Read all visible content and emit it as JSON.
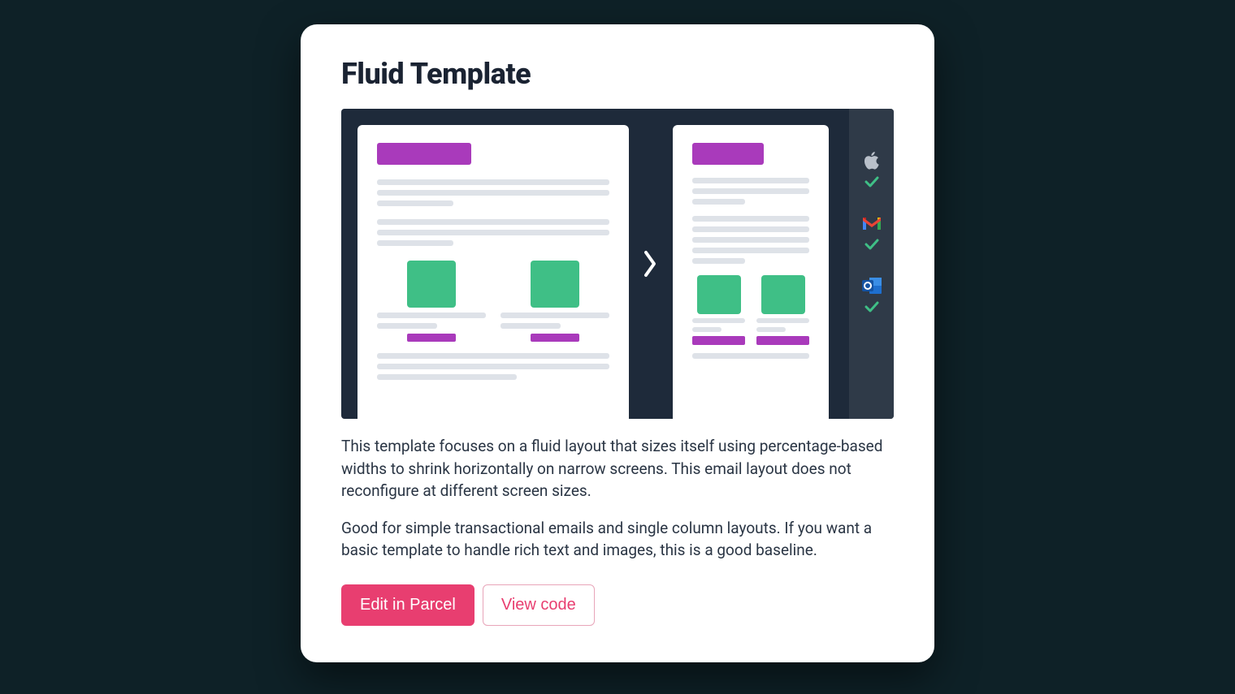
{
  "card": {
    "title": "Fluid Template",
    "description1": "This template focuses on a fluid layout that sizes itself using percentage-based widths to shrink horizontally on narrow screens. This email layout does not reconfigure at different screen sizes.",
    "description2": "Good for simple transactional emails and single column layouts. If you want a basic template to handle rich text and images, this is a good baseline.",
    "primary_button": "Edit in Parcel",
    "secondary_button": "View code"
  },
  "compat": {
    "apple": "ok",
    "gmail": "ok",
    "outlook": "ok"
  },
  "colors": {
    "accent_purple": "#a93abb",
    "accent_green": "#3fbf86",
    "pink": "#e83e70",
    "dark": "#1e2a3a",
    "page_bg": "#0e2127"
  }
}
